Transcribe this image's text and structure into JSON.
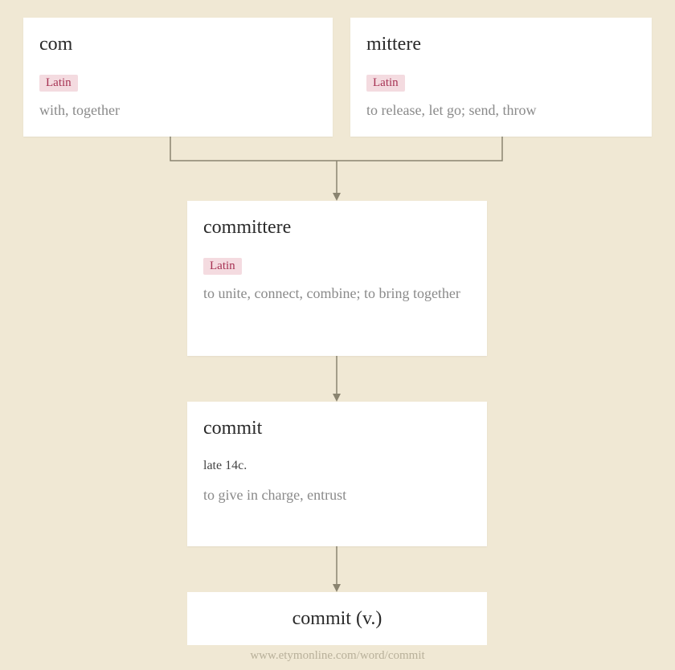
{
  "nodes": {
    "com": {
      "word": "com",
      "language": "Latin",
      "definition": "with, together"
    },
    "mittere": {
      "word": "mittere",
      "language": "Latin",
      "definition": "to release, let go; send, throw"
    },
    "committere": {
      "word": "committere",
      "language": "Latin",
      "definition": "to unite, connect, combine; to bring together"
    },
    "commit": {
      "word": "commit",
      "date": "late 14c.",
      "definition": "to give in charge, entrust"
    },
    "final": {
      "word": "commit (v.)"
    }
  },
  "attribution": "www.etymonline.com/word/commit"
}
